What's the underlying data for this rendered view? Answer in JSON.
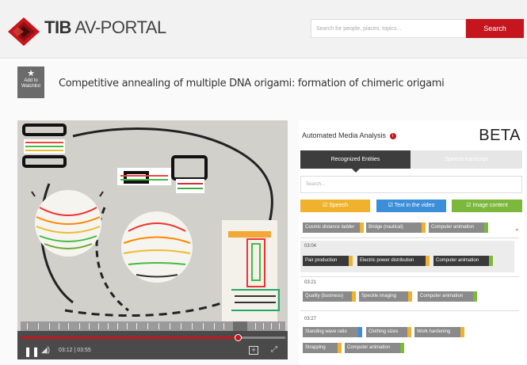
{
  "header": {
    "brand_bold": "TIB",
    "brand_light": "AV-PORTAL",
    "search_placeholder": "Search for people, places, topics...",
    "search_button": "Search",
    "accent": "#c4161c"
  },
  "page": {
    "watchlist_icon": "star-icon",
    "watchlist_line1": "Add to",
    "watchlist_line2": "Watchlist",
    "title": "Competitive annealing of multiple DNA origami: formation of chimeric origami"
  },
  "player": {
    "time": "03:12 | 03:55",
    "progress": 0.82,
    "play_icon": "pause-icon",
    "volume_icon": "volume-icon",
    "addclip_icon": "plus-box-icon",
    "fullscreen_icon": "fullscreen-icon"
  },
  "panel": {
    "title": "Automated Media Analysis",
    "beta": "BETA",
    "tabs": [
      "Recognized Entities",
      "Speech transcript"
    ],
    "search_placeholder": "Search...",
    "filters": [
      "Speech",
      "Text in the video",
      "Image content"
    ],
    "top_row": [
      "Cosmic distance ladder",
      "Bridge (nautical)",
      "Computer animation"
    ],
    "segments": [
      {
        "time": "03:04",
        "tags": [
          "Pair production",
          "Electric power distribution",
          "Computer animation"
        ]
      },
      {
        "time": "03:21",
        "tags": [
          "Quality (business)",
          "Speckle imaging",
          "Computer animation"
        ]
      },
      {
        "time": "03:27",
        "tags": [
          "Standing wave ratio",
          "Clothing sizes",
          "Work hardening",
          "Strapping",
          "Computer animation"
        ]
      }
    ]
  }
}
